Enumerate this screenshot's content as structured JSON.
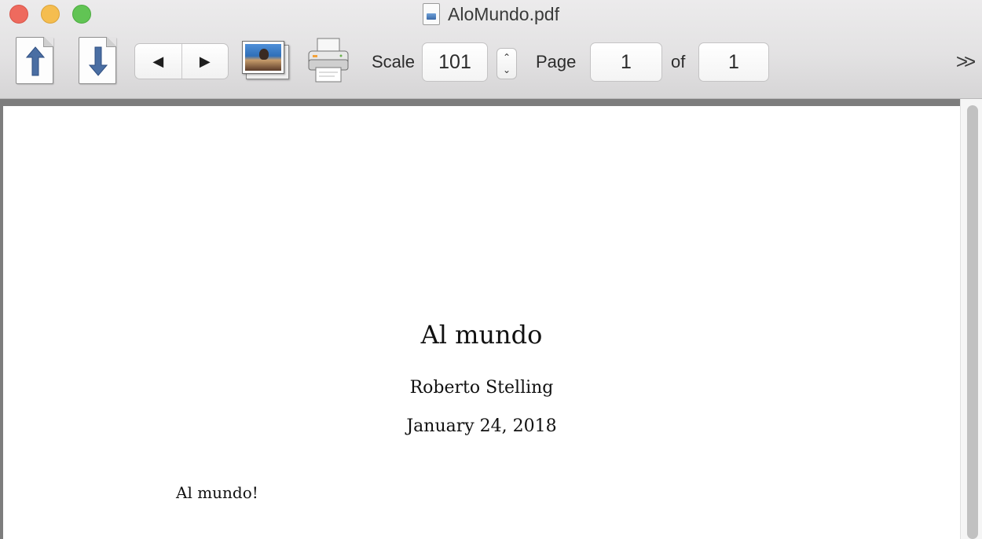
{
  "window": {
    "title": "AloMundo.pdf"
  },
  "toolbar": {
    "scale_label": "Scale",
    "scale_value": "101",
    "page_label": "Page",
    "page_value": "1",
    "of_label": "of",
    "page_total": "1",
    "overflow_label": ">>",
    "prev_icon": "◀",
    "next_icon": "▶",
    "stepper_up": "⌃",
    "stepper_down": "⌄"
  },
  "document": {
    "title": "Al mundo",
    "author": "Roberto Stelling",
    "date": "January 24, 2018",
    "body": "Al mundo!"
  },
  "colors": {
    "close": "#ee6a5e",
    "minimize": "#f5bd4f",
    "maximize": "#61c454",
    "arrow_blue": "#4a6ea3",
    "viewer_bg": "#7d7d7d"
  }
}
